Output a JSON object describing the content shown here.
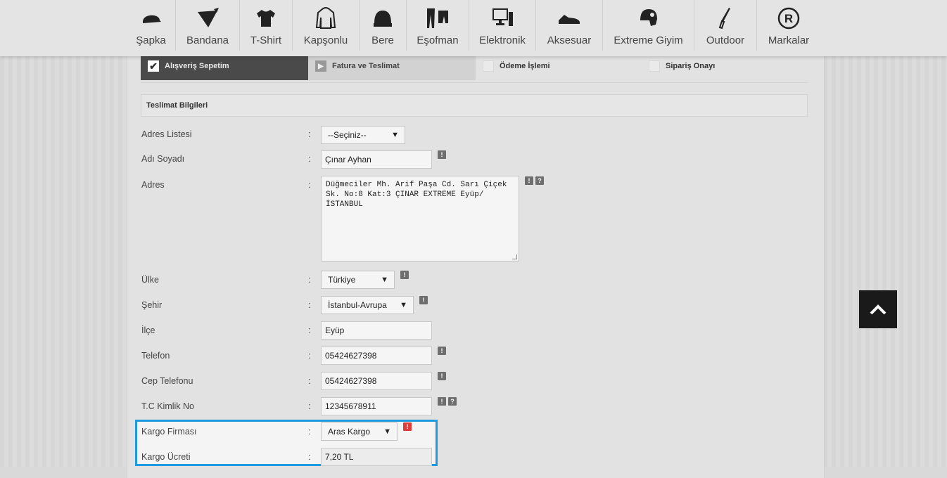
{
  "nav": [
    {
      "label": "Şapka",
      "icon": "cap-icon"
    },
    {
      "label": "Bandana",
      "icon": "bandana-icon"
    },
    {
      "label": "T-Shirt",
      "icon": "tshirt-icon"
    },
    {
      "label": "Kapşonlu",
      "icon": "hoodie-icon"
    },
    {
      "label": "Bere",
      "icon": "beanie-icon"
    },
    {
      "label": "Eşofman",
      "icon": "tracksuit-icon"
    },
    {
      "label": "Elektronik",
      "icon": "computer-icon"
    },
    {
      "label": "Aksesuar",
      "icon": "shoe-icon"
    },
    {
      "label": "Extreme Giyim",
      "icon": "helmet-icon"
    },
    {
      "label": "Outdoor",
      "icon": "knife-icon"
    },
    {
      "label": "Markalar",
      "icon": "registered-icon"
    }
  ],
  "steps": [
    {
      "label": "Alışveriş Sepetim",
      "state": "done"
    },
    {
      "label": "Fatura ve Teslimat",
      "state": "current"
    },
    {
      "label": "Ödeme İşlemi",
      "state": "todo"
    },
    {
      "label": "Sipariş Onayı",
      "state": "todo"
    }
  ],
  "section_title": "Teslimat Bilgileri",
  "form": {
    "colon": ":",
    "address_list": {
      "label": "Adres Listesi",
      "value": "--Seçiniz--"
    },
    "full_name": {
      "label": "Adı Soyadı",
      "value": "Çınar Ayhan"
    },
    "address": {
      "label": "Adres",
      "value": "Düğmeciler Mh. Arif Paşa Cd. Sarı Çiçek\nSk. No:8 Kat:3 ÇINAR EXTREME Eyüp/\nİSTANBUL"
    },
    "country": {
      "label": "Ülke",
      "value": "Türkiye"
    },
    "city": {
      "label": "Şehir",
      "value": "İstanbul-Avrupa"
    },
    "district": {
      "label": "İlçe",
      "value": "Eyüp"
    },
    "phone": {
      "label": "Telefon",
      "value": "05424627398"
    },
    "mobile": {
      "label": "Cep Telefonu",
      "value": "05424627398"
    },
    "tc_id": {
      "label": "T.C Kimlik No",
      "value": "12345678911"
    },
    "cargo_company": {
      "label": "Kargo Firması",
      "value": "Aras Kargo"
    },
    "cargo_fee": {
      "label": "Kargo Ücreti",
      "value": "7,20 TL"
    }
  },
  "badges": {
    "required": "!",
    "help": "?"
  },
  "colors": {
    "highlight": "#1e9be0",
    "required_alert": "#e03a3a"
  }
}
